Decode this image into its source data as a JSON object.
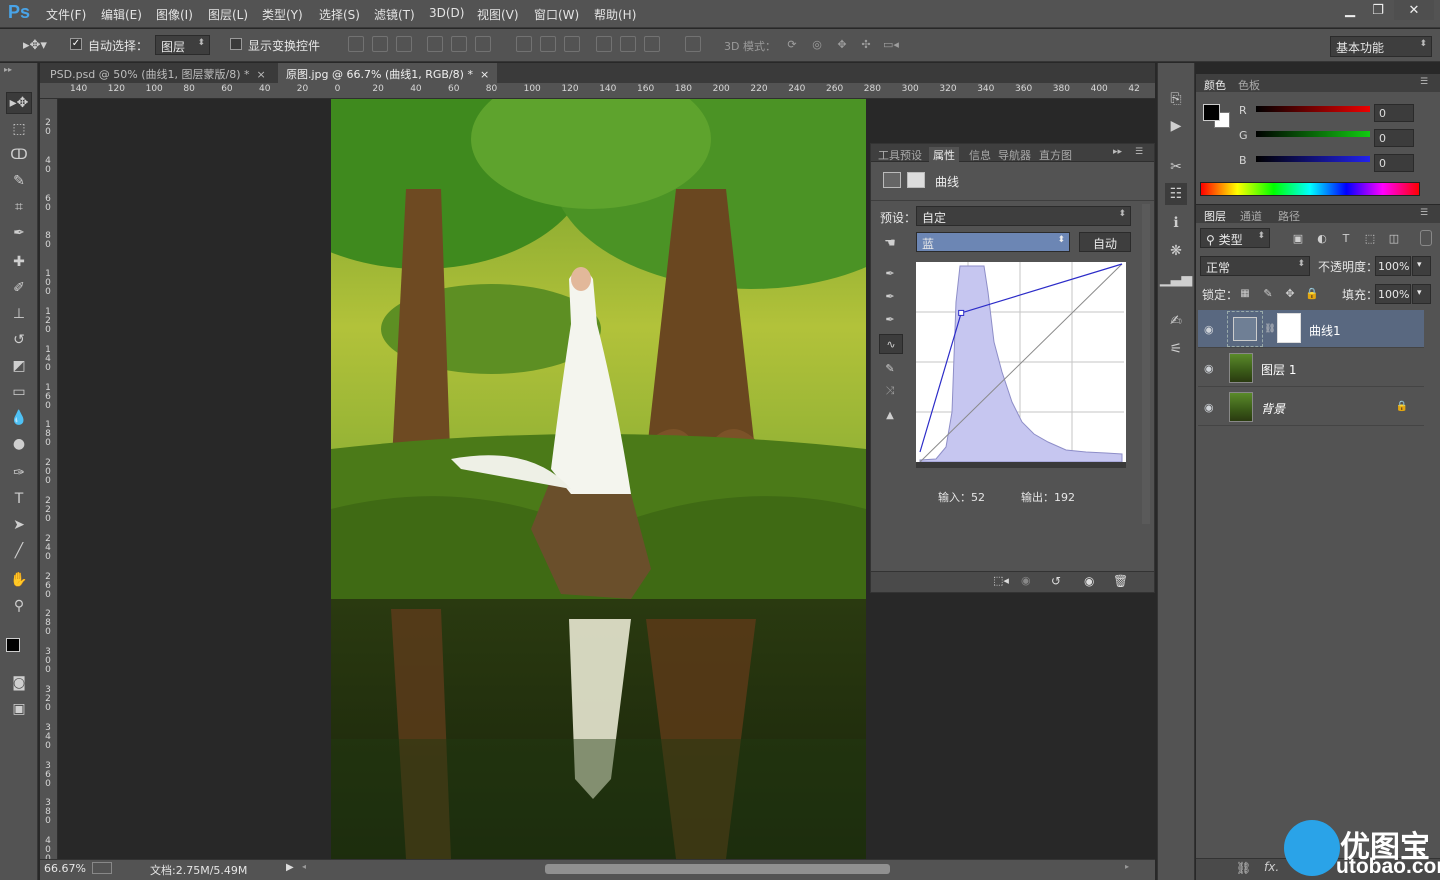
{
  "app": {
    "logo": "Ps"
  },
  "menu": [
    "文件(F)",
    "编辑(E)",
    "图像(I)",
    "图层(L)",
    "类型(Y)",
    "选择(S)",
    "滤镜(T)",
    "3D(D)",
    "视图(V)",
    "窗口(W)",
    "帮助(H)"
  ],
  "options": {
    "auto_select_label": "自动选择：",
    "auto_select_checked": true,
    "auto_select_target": "图层",
    "transform_label": "显示变换控件",
    "mode_3d_label": "3D 模式：",
    "workspace": "基本功能"
  },
  "tabs": [
    {
      "label": "PSD.psd @ 50% (曲线1, 图层蒙版/8) *",
      "active": false,
      "close": "×"
    },
    {
      "label": "原图.jpg @ 66.7% (曲线1, RGB/8) *",
      "active": true,
      "close": "×"
    }
  ],
  "ruler_top": [
    "140",
    "120",
    "100",
    "80",
    "60",
    "40",
    "20",
    "0",
    "20",
    "40",
    "60",
    "80",
    "100",
    "120",
    "140",
    "160",
    "180",
    "200",
    "220",
    "240",
    "260",
    "280",
    "300",
    "320",
    "340",
    "360",
    "380",
    "400",
    "42"
  ],
  "ruler_left": [
    "2\n0",
    "4\n0",
    "6\n0",
    "8\n0",
    "1\n0\n0",
    "1\n2\n0",
    "1\n4\n0",
    "1\n6\n0",
    "1\n8\n0",
    "2\n0\n0",
    "2\n2\n0",
    "2\n4\n0",
    "2\n6\n0",
    "2\n8\n0",
    "3\n0\n0",
    "3\n2\n0",
    "3\n4\n0",
    "3\n6\n0",
    "3\n8\n0",
    "4\n0\n0"
  ],
  "status": {
    "zoom": "66.67%",
    "doc": "文档:2.75M/5.49M"
  },
  "properties": {
    "tabs": [
      "工具预设",
      "属性",
      "信息",
      "导航器",
      "直方图"
    ],
    "active_tab": "属性",
    "title": "曲线",
    "preset_label": "预设：",
    "preset_value": "自定",
    "channel": "蓝",
    "auto_button": "自动",
    "input_label": "输入：52",
    "output_label": "输出：192",
    "curve_point": {
      "input": 52,
      "output": 192
    }
  },
  "color_panel": {
    "tabs": [
      "颜色",
      "色板"
    ],
    "channels": [
      {
        "label": "R",
        "value": "0",
        "color": "#e02020"
      },
      {
        "label": "G",
        "value": "0",
        "color": "#20c020"
      },
      {
        "label": "B",
        "value": "0",
        "color": "#2020e0"
      }
    ],
    "foreground": "#000000",
    "background": "#ffffff"
  },
  "layers_panel": {
    "tabs": [
      "图层",
      "通道",
      "路径"
    ],
    "filter": "类型",
    "blend_mode": "正常",
    "opacity_label": "不透明度：",
    "opacity": "100%",
    "lock_label": "锁定：",
    "fill_label": "填充：",
    "fill": "100%",
    "layers": [
      {
        "name": "曲线1",
        "active": true
      },
      {
        "name": "图层 1",
        "active": false
      },
      {
        "name": "背景",
        "active": false,
        "locked": true
      }
    ],
    "footer_icons": [
      "link-icon",
      "fx-icon"
    ]
  },
  "watermark": {
    "brand": "优图宝",
    "url": "utobao.com"
  }
}
